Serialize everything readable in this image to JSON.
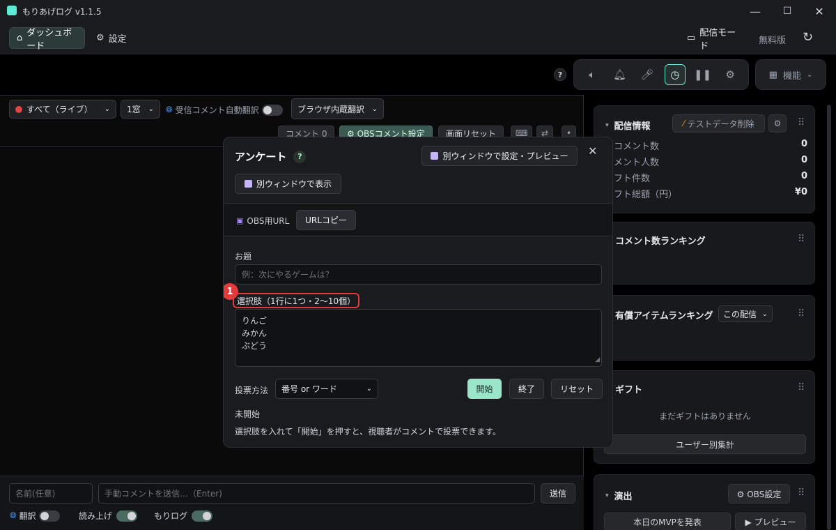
{
  "window": {
    "title": "もりあげログ v1.1.5",
    "controls": [
      "—",
      "☐",
      "✕"
    ]
  },
  "nav": {
    "dashboard": "ダッシュボード",
    "settings": "設定",
    "broadcast_mode": "配信モード",
    "free_version": "無料版"
  },
  "toolbar": {
    "help": "?",
    "features": "機能"
  },
  "left": {
    "source_select": "すべて（ライブ）",
    "window_select": "1窓",
    "auto_translate_label": "受信コメント自動翻訳",
    "translate_engine": "ブラウザ内蔵翻訳",
    "comment_chip": "コメント 0",
    "obs_comment_settings": "⚙ OBSコメント設定",
    "screen_reset": "画面リセット",
    "name_placeholder": "名前(任意)",
    "manual_comment_placeholder": "手動コメントを送信…（Enter)",
    "send_button": "送信",
    "translate_label": "翻訳",
    "readout_label": "読み上げ",
    "morilog_label": "もりログ"
  },
  "right": {
    "stream_info": {
      "title": "配信情報",
      "delete_test_data": "テストデータ削除",
      "rows": [
        {
          "label": "コメント数",
          "value": "0"
        },
        {
          "label": "メント人数",
          "value": "0"
        },
        {
          "label": "フト件数",
          "value": "0"
        },
        {
          "label": "フト総額（円）",
          "value": "¥0"
        }
      ]
    },
    "comment_ranking": {
      "title": "コメント数ランキング"
    },
    "paid_ranking": {
      "title": "有償アイテムランキング",
      "scope": "この配信"
    },
    "gift": {
      "title": "ギフト",
      "empty": "まだギフトはありません",
      "per_user": "ユーザー別集計"
    },
    "effects": {
      "title": "演出",
      "obs_settings": "⚙ OBS設定",
      "mvp": "本日のMVPを発表",
      "preview": "▶ プレビュー"
    }
  },
  "modal": {
    "title": "アンケート",
    "help": "?",
    "open_settings_window": "別ウィンドウで設定・プレビュー",
    "show_separate_window": "別ウィンドウで表示",
    "obs_url_label": "OBS用URL",
    "url_copy": "URLコピー",
    "topic_label": "お題",
    "topic_placeholder": "例：次にやるゲームは？",
    "choices_label": "選択肢（1行に1つ・2〜10個）",
    "choices_lines": [
      "りんご",
      "みかん",
      "ぶどう"
    ],
    "annotation_number": "1",
    "vote_method_label": "投票方法",
    "vote_method_value": "番号 or ワード",
    "start": "開始",
    "end": "終了",
    "reset": "リセット",
    "status": "未開始",
    "hint": "選択肢を入れて「開始」を押すと、視聴者がコメントで投票できます。"
  },
  "colors": {
    "accent": "#5eead4",
    "start_button": "#99e6c9",
    "annotation": "#e23b3b",
    "danger_dot": "#e04646"
  }
}
